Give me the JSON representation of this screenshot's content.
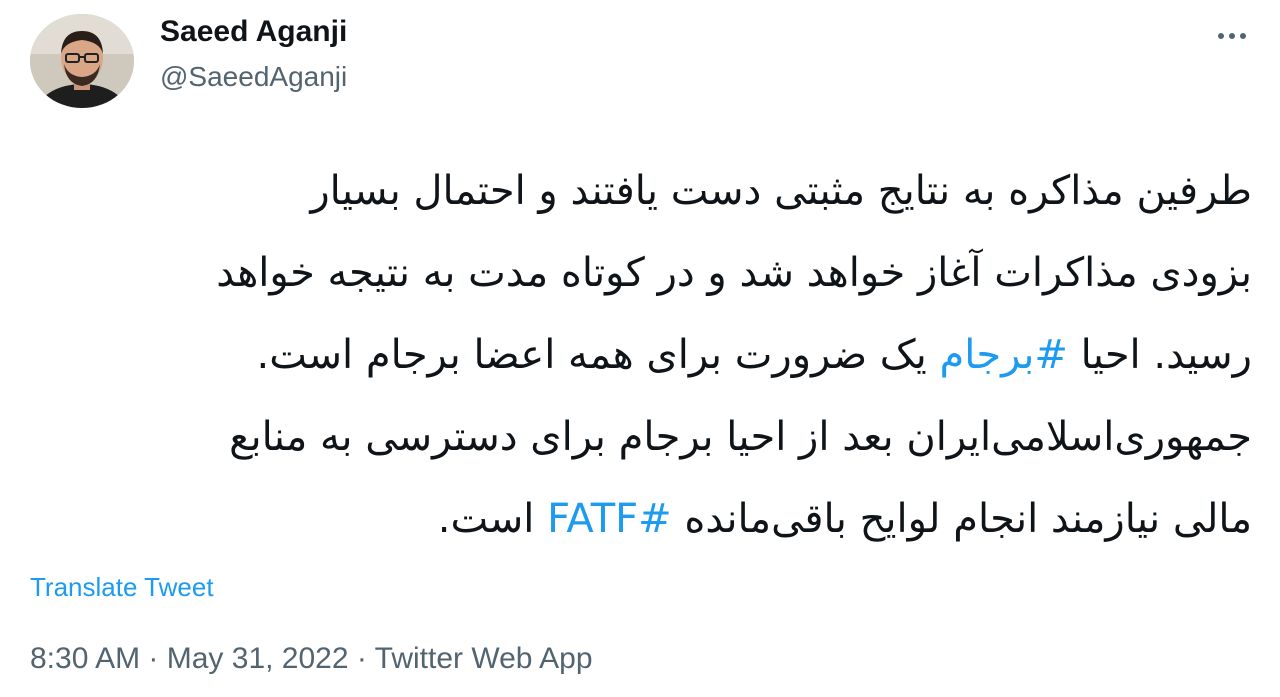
{
  "author": {
    "display_name": "Saeed Aganji",
    "handle": "@SaeedAganji"
  },
  "more_icon": "more-horizontal-icon",
  "tweet": {
    "lines": [
      [
        {
          "text": "طرفین مذاکره به نتایج مثبتی دست یافتند و احتمال بسیار",
          "hashtag": false
        }
      ],
      [
        {
          "text": "بزودی مذاکرات آغاز خواهد شد و در کوتاه مدت به نتیجه خواهد",
          "hashtag": false
        }
      ],
      [
        {
          "text": "رسید. احیا ",
          "hashtag": false
        },
        {
          "text": "#برجام",
          "hashtag": true
        },
        {
          "text": " یک ضرورت برای همه اعضا برجام است.",
          "hashtag": false
        }
      ],
      [
        {
          "text": "جمهوری‌اسلامی‌ایران بعد از احیا برجام برای دسترسی به منابع",
          "hashtag": false
        }
      ],
      [
        {
          "text": "مالی نیازمند انجام لوایح باقی‌مانده ",
          "hashtag": false
        },
        {
          "text": "#FATF",
          "hashtag": true
        },
        {
          "text": " است.",
          "hashtag": false
        }
      ]
    ]
  },
  "translate_label": "Translate Tweet",
  "meta": {
    "time": "8:30 AM",
    "separator": " · ",
    "date": "May 31, 2022",
    "source": "Twitter Web App"
  },
  "colors": {
    "link": "#1d9bf0",
    "text": "#0f1419",
    "secondary": "#536471"
  }
}
